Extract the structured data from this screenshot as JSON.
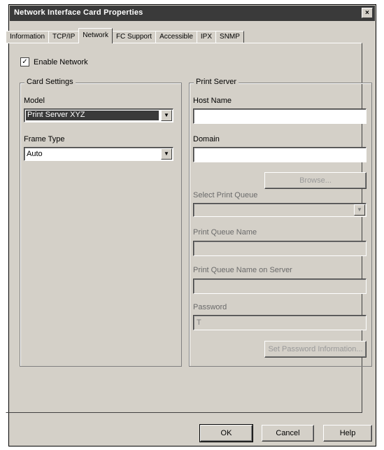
{
  "window": {
    "title": "Network Interface Card Properties",
    "close_glyph": "×"
  },
  "tabs": [
    {
      "label": "Information"
    },
    {
      "label": "TCP/IP"
    },
    {
      "label": "Network"
    },
    {
      "label": "FC Support"
    },
    {
      "label": "Accessible"
    },
    {
      "label": "IPX"
    },
    {
      "label": "SNMP"
    }
  ],
  "active_tab": "Network",
  "enable": {
    "label": "Enable Network",
    "checked": true
  },
  "card_settings": {
    "legend": "Card Settings",
    "model_label": "Model",
    "model_value": "Print Server XYZ",
    "frame_label": "Frame Type",
    "frame_value": "Auto"
  },
  "print_server": {
    "legend": "Print Server",
    "host_name_label": "Host Name",
    "host_name_value": "",
    "domain_label": "Domain",
    "domain_value": "",
    "browse_label": "Browse...",
    "select_print_label": "Select Print Queue",
    "select_print_value": "",
    "queue_name_label": "Print Queue Name",
    "queue_name_value": "",
    "queue_name_on_server_label": "Print Queue Name on Server",
    "queue_name_on_server_value": "",
    "password_label": "Password",
    "password_value": "T",
    "set_password_label": "Set Password Information..."
  },
  "footer": {
    "ok_label": "OK",
    "cancel_label": "Cancel",
    "help_label": "Help"
  },
  "colors": {
    "title_bar": "#3a3a3a",
    "window_face": "#d4d0c8",
    "selection": "#3a3a3a"
  }
}
